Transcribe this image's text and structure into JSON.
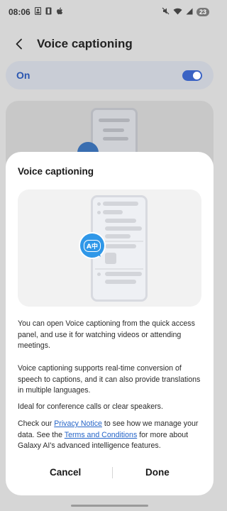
{
  "status_bar": {
    "time": "08:06",
    "left_icons": [
      "portrait-icon",
      "square-icon",
      "apple-icon"
    ],
    "right_icons": [
      "mute-icon",
      "wifi-icon",
      "signal-icon"
    ],
    "battery": "23"
  },
  "header": {
    "title": "Voice captioning"
  },
  "toggle": {
    "label": "On",
    "state": "on"
  },
  "sheet": {
    "title": "Voice captioning",
    "illustration": {
      "bubble_text": "A中"
    },
    "para1": "You can open Voice captioning from the quick access panel, and use it for watching videos or attending meetings.",
    "para2": "Voice captioning supports real-time conversion of speech to captions, and it can also provide translations in multiple languages.",
    "para3": "Ideal for conference calls or clear speakers.",
    "para4": {
      "prefix": "Check our ",
      "privacy_link": "Privacy Notice",
      "middle": " to see how we manage your data. See the ",
      "terms_link": "Terms and Conditions",
      "suffix": " for more about Galaxy AI's advanced intelligence features."
    },
    "cancel_label": "Cancel",
    "done_label": "Done"
  },
  "colors": {
    "accent": "#3b63c4",
    "link": "#2464c8",
    "bubble": "#2f97e8"
  }
}
